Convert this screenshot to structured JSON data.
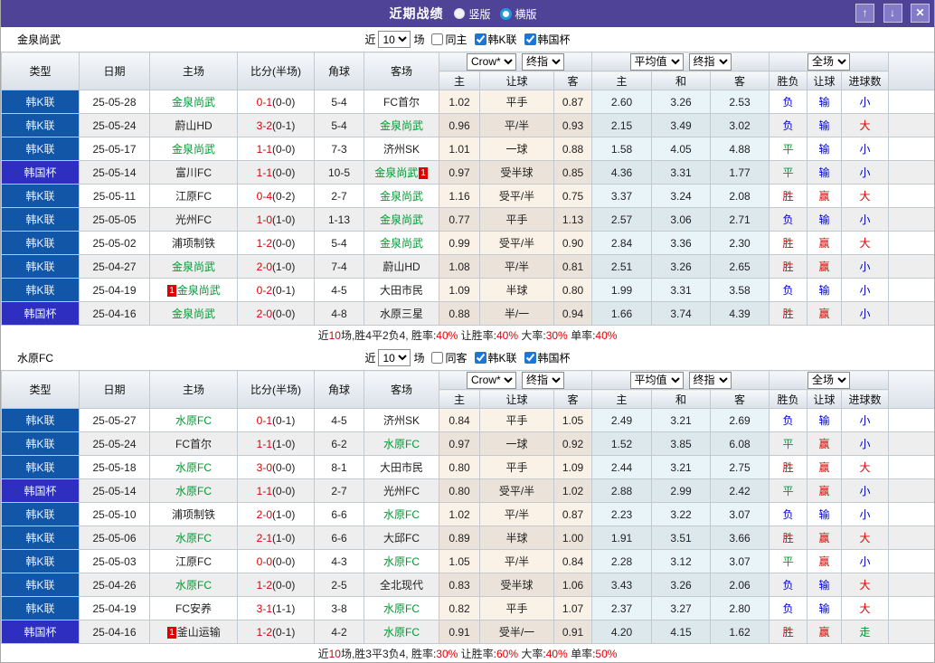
{
  "titlebar": {
    "title": "近期战绩",
    "layout_options": [
      {
        "label": "竖版",
        "selected": false
      },
      {
        "label": "横版",
        "selected": true
      }
    ],
    "window_buttons": {
      "up": "↑",
      "down": "↓",
      "close": "✕"
    }
  },
  "table_header": {
    "left_columns": [
      "类型",
      "日期",
      "主场",
      "比分(半场)",
      "角球",
      "客场"
    ],
    "odds_group": {
      "company_select": "Crow*",
      "stage_select": "终指",
      "subheaders": [
        "主",
        "让球",
        "客"
      ]
    },
    "avg_group": {
      "avg_select": "平均值",
      "stage_select": "终指",
      "subheaders": [
        "主",
        "和",
        "客"
      ]
    },
    "result_group": {
      "scope_select": "全场",
      "subheaders": [
        "胜负",
        "让球",
        "进球数"
      ]
    }
  },
  "colors": {
    "titlebar_bg": "#4f4398",
    "league_type_bg": "#1256a8",
    "cup_type_bg": "#2e2ec0",
    "focus_team": "#009933",
    "win_red": "#e10000",
    "draw_green": "#009933",
    "loss_blue": "#0000cc"
  },
  "sections": [
    {
      "team": "金泉尚武",
      "filter": {
        "prefix": "近",
        "count": "10",
        "suffix": "场",
        "same": {
          "label": "同主",
          "checked": false
        },
        "league": {
          "label": "韩K联",
          "checked": true
        },
        "cup": {
          "label": "韩国杯",
          "checked": true
        }
      },
      "rows": [
        {
          "type": "韩K联",
          "cup": false,
          "date": "25-05-28",
          "home": {
            "name": "金泉尚武",
            "focus": true
          },
          "score": "0-1",
          "half": "(0-0)",
          "corner": "5-4",
          "away": {
            "name": "FC首尔",
            "focus": false
          },
          "odds": [
            "1.02",
            "平手",
            "0.87"
          ],
          "avg": [
            "2.60",
            "3.26",
            "2.53"
          ],
          "res": [
            [
              "负",
              "B"
            ],
            [
              "输",
              "B"
            ],
            [
              "小",
              "B"
            ]
          ]
        },
        {
          "type": "韩K联",
          "cup": false,
          "date": "25-05-24",
          "home": {
            "name": "蔚山HD",
            "focus": false
          },
          "score": "3-2",
          "half": "(0-1)",
          "corner": "5-4",
          "away": {
            "name": "金泉尚武",
            "focus": true
          },
          "odds": [
            "0.96",
            "平/半",
            "0.93"
          ],
          "avg": [
            "2.15",
            "3.49",
            "3.02"
          ],
          "res": [
            [
              "负",
              "B"
            ],
            [
              "输",
              "B"
            ],
            [
              "大",
              "R"
            ]
          ]
        },
        {
          "type": "韩K联",
          "cup": false,
          "date": "25-05-17",
          "home": {
            "name": "金泉尚武",
            "focus": true
          },
          "score": "1-1",
          "half": "(0-0)",
          "corner": "7-3",
          "away": {
            "name": "济州SK",
            "focus": false
          },
          "odds": [
            "1.01",
            "一球",
            "0.88"
          ],
          "avg": [
            "1.58",
            "4.05",
            "4.88"
          ],
          "res": [
            [
              "平",
              "G"
            ],
            [
              "输",
              "B"
            ],
            [
              "小",
              "B"
            ]
          ]
        },
        {
          "type": "韩国杯",
          "cup": true,
          "date": "25-05-14",
          "home": {
            "name": "富川FC",
            "focus": false
          },
          "score": "1-1",
          "half": "(0-0)",
          "corner": "10-5",
          "away": {
            "name": "金泉尚武",
            "focus": true,
            "badge": "1",
            "badge_pos": "after"
          },
          "odds": [
            "0.97",
            "受半球",
            "0.85"
          ],
          "avg": [
            "4.36",
            "3.31",
            "1.77"
          ],
          "res": [
            [
              "平",
              "G"
            ],
            [
              "输",
              "B"
            ],
            [
              "小",
              "B"
            ]
          ]
        },
        {
          "type": "韩K联",
          "cup": false,
          "date": "25-05-11",
          "home": {
            "name": "江原FC",
            "focus": false
          },
          "score": "0-4",
          "half": "(0-2)",
          "corner": "2-7",
          "away": {
            "name": "金泉尚武",
            "focus": true
          },
          "odds": [
            "1.16",
            "受平/半",
            "0.75"
          ],
          "avg": [
            "3.37",
            "3.24",
            "2.08"
          ],
          "res": [
            [
              "胜",
              "R"
            ],
            [
              "赢",
              "R"
            ],
            [
              "大",
              "R"
            ]
          ]
        },
        {
          "type": "韩K联",
          "cup": false,
          "date": "25-05-05",
          "home": {
            "name": "光州FC",
            "focus": false
          },
          "score": "1-0",
          "half": "(1-0)",
          "corner": "1-13",
          "away": {
            "name": "金泉尚武",
            "focus": true
          },
          "odds": [
            "0.77",
            "平手",
            "1.13"
          ],
          "avg": [
            "2.57",
            "3.06",
            "2.71"
          ],
          "res": [
            [
              "负",
              "B"
            ],
            [
              "输",
              "B"
            ],
            [
              "小",
              "B"
            ]
          ]
        },
        {
          "type": "韩K联",
          "cup": false,
          "date": "25-05-02",
          "home": {
            "name": "浦项制铁",
            "focus": false
          },
          "score": "1-2",
          "half": "(0-0)",
          "corner": "5-4",
          "away": {
            "name": "金泉尚武",
            "focus": true
          },
          "odds": [
            "0.99",
            "受平/半",
            "0.90"
          ],
          "avg": [
            "2.84",
            "3.36",
            "2.30"
          ],
          "res": [
            [
              "胜",
              "R"
            ],
            [
              "赢",
              "R"
            ],
            [
              "大",
              "R"
            ]
          ]
        },
        {
          "type": "韩K联",
          "cup": false,
          "date": "25-04-27",
          "home": {
            "name": "金泉尚武",
            "focus": true
          },
          "score": "2-0",
          "half": "(1-0)",
          "corner": "7-4",
          "away": {
            "name": "蔚山HD",
            "focus": false
          },
          "odds": [
            "1.08",
            "平/半",
            "0.81"
          ],
          "avg": [
            "2.51",
            "3.26",
            "2.65"
          ],
          "res": [
            [
              "胜",
              "R"
            ],
            [
              "赢",
              "R"
            ],
            [
              "小",
              "B"
            ]
          ]
        },
        {
          "type": "韩K联",
          "cup": false,
          "date": "25-04-19",
          "home": {
            "name": "金泉尚武",
            "focus": true,
            "badge": "1",
            "badge_pos": "before"
          },
          "score": "0-2",
          "half": "(0-1)",
          "corner": "4-5",
          "away": {
            "name": "大田市民",
            "focus": false
          },
          "odds": [
            "1.09",
            "半球",
            "0.80"
          ],
          "avg": [
            "1.99",
            "3.31",
            "3.58"
          ],
          "res": [
            [
              "负",
              "B"
            ],
            [
              "输",
              "B"
            ],
            [
              "小",
              "B"
            ]
          ]
        },
        {
          "type": "韩国杯",
          "cup": true,
          "date": "25-04-16",
          "home": {
            "name": "金泉尚武",
            "focus": true
          },
          "score": "2-0",
          "half": "(0-0)",
          "corner": "4-8",
          "away": {
            "name": "水原三星",
            "focus": false
          },
          "odds": [
            "0.88",
            "半/一",
            "0.94"
          ],
          "avg": [
            "1.66",
            "3.74",
            "4.39"
          ],
          "res": [
            [
              "胜",
              "R"
            ],
            [
              "赢",
              "R"
            ],
            [
              "小",
              "B"
            ]
          ]
        }
      ],
      "summary": [
        [
          "近",
          0
        ],
        [
          "10",
          1
        ],
        [
          "场,胜4平2负4, 胜率:",
          0
        ],
        [
          "40%",
          1
        ],
        [
          " 让胜率:",
          0
        ],
        [
          "40%",
          1
        ],
        [
          " 大率:",
          0
        ],
        [
          "30%",
          1
        ],
        [
          " 单率:",
          0
        ],
        [
          "40%",
          1
        ]
      ]
    },
    {
      "team": "水原FC",
      "filter": {
        "prefix": "近",
        "count": "10",
        "suffix": "场",
        "same": {
          "label": "同客",
          "checked": false
        },
        "league": {
          "label": "韩K联",
          "checked": true
        },
        "cup": {
          "label": "韩国杯",
          "checked": true
        }
      },
      "rows": [
        {
          "type": "韩K联",
          "cup": false,
          "date": "25-05-27",
          "home": {
            "name": "水原FC",
            "focus": true
          },
          "score": "0-1",
          "half": "(0-1)",
          "corner": "4-5",
          "away": {
            "name": "济州SK",
            "focus": false
          },
          "odds": [
            "0.84",
            "平手",
            "1.05"
          ],
          "avg": [
            "2.49",
            "3.21",
            "2.69"
          ],
          "res": [
            [
              "负",
              "B"
            ],
            [
              "输",
              "B"
            ],
            [
              "小",
              "B"
            ]
          ]
        },
        {
          "type": "韩K联",
          "cup": false,
          "date": "25-05-24",
          "home": {
            "name": "FC首尔",
            "focus": false
          },
          "score": "1-1",
          "half": "(1-0)",
          "corner": "6-2",
          "away": {
            "name": "水原FC",
            "focus": true
          },
          "odds": [
            "0.97",
            "一球",
            "0.92"
          ],
          "avg": [
            "1.52",
            "3.85",
            "6.08"
          ],
          "res": [
            [
              "平",
              "G"
            ],
            [
              "赢",
              "R"
            ],
            [
              "小",
              "B"
            ]
          ]
        },
        {
          "type": "韩K联",
          "cup": false,
          "date": "25-05-18",
          "home": {
            "name": "水原FC",
            "focus": true
          },
          "score": "3-0",
          "half": "(0-0)",
          "corner": "8-1",
          "away": {
            "name": "大田市民",
            "focus": false
          },
          "odds": [
            "0.80",
            "平手",
            "1.09"
          ],
          "avg": [
            "2.44",
            "3.21",
            "2.75"
          ],
          "res": [
            [
              "胜",
              "R"
            ],
            [
              "赢",
              "R"
            ],
            [
              "大",
              "R"
            ]
          ]
        },
        {
          "type": "韩国杯",
          "cup": true,
          "date": "25-05-14",
          "home": {
            "name": "水原FC",
            "focus": true
          },
          "score": "1-1",
          "half": "(0-0)",
          "corner": "2-7",
          "away": {
            "name": "光州FC",
            "focus": false
          },
          "odds": [
            "0.80",
            "受平/半",
            "1.02"
          ],
          "avg": [
            "2.88",
            "2.99",
            "2.42"
          ],
          "res": [
            [
              "平",
              "G"
            ],
            [
              "赢",
              "R"
            ],
            [
              "小",
              "B"
            ]
          ]
        },
        {
          "type": "韩K联",
          "cup": false,
          "date": "25-05-10",
          "home": {
            "name": "浦项制铁",
            "focus": false
          },
          "score": "2-0",
          "half": "(1-0)",
          "corner": "6-6",
          "away": {
            "name": "水原FC",
            "focus": true
          },
          "odds": [
            "1.02",
            "平/半",
            "0.87"
          ],
          "avg": [
            "2.23",
            "3.22",
            "3.07"
          ],
          "res": [
            [
              "负",
              "B"
            ],
            [
              "输",
              "B"
            ],
            [
              "小",
              "B"
            ]
          ]
        },
        {
          "type": "韩K联",
          "cup": false,
          "date": "25-05-06",
          "home": {
            "name": "水原FC",
            "focus": true
          },
          "score": "2-1",
          "half": "(1-0)",
          "corner": "6-6",
          "away": {
            "name": "大邱FC",
            "focus": false
          },
          "odds": [
            "0.89",
            "半球",
            "1.00"
          ],
          "avg": [
            "1.91",
            "3.51",
            "3.66"
          ],
          "res": [
            [
              "胜",
              "R"
            ],
            [
              "赢",
              "R"
            ],
            [
              "大",
              "R"
            ]
          ]
        },
        {
          "type": "韩K联",
          "cup": false,
          "date": "25-05-03",
          "home": {
            "name": "江原FC",
            "focus": false
          },
          "score": "0-0",
          "half": "(0-0)",
          "corner": "4-3",
          "away": {
            "name": "水原FC",
            "focus": true
          },
          "odds": [
            "1.05",
            "平/半",
            "0.84"
          ],
          "avg": [
            "2.28",
            "3.12",
            "3.07"
          ],
          "res": [
            [
              "平",
              "G"
            ],
            [
              "赢",
              "R"
            ],
            [
              "小",
              "B"
            ]
          ]
        },
        {
          "type": "韩K联",
          "cup": false,
          "date": "25-04-26",
          "home": {
            "name": "水原FC",
            "focus": true
          },
          "score": "1-2",
          "half": "(0-0)",
          "corner": "2-5",
          "away": {
            "name": "全北现代",
            "focus": false
          },
          "odds": [
            "0.83",
            "受半球",
            "1.06"
          ],
          "avg": [
            "3.43",
            "3.26",
            "2.06"
          ],
          "res": [
            [
              "负",
              "B"
            ],
            [
              "输",
              "B"
            ],
            [
              "大",
              "R"
            ]
          ]
        },
        {
          "type": "韩K联",
          "cup": false,
          "date": "25-04-19",
          "home": {
            "name": "FC安养",
            "focus": false
          },
          "score": "3-1",
          "half": "(1-1)",
          "corner": "3-8",
          "away": {
            "name": "水原FC",
            "focus": true
          },
          "odds": [
            "0.82",
            "平手",
            "1.07"
          ],
          "avg": [
            "2.37",
            "3.27",
            "2.80"
          ],
          "res": [
            [
              "负",
              "B"
            ],
            [
              "输",
              "B"
            ],
            [
              "大",
              "R"
            ]
          ]
        },
        {
          "type": "韩国杯",
          "cup": true,
          "date": "25-04-16",
          "home": {
            "name": "釜山运输",
            "focus": false,
            "badge": "1",
            "badge_pos": "before"
          },
          "score": "1-2",
          "half": "(0-1)",
          "corner": "4-2",
          "away": {
            "name": "水原FC",
            "focus": true
          },
          "odds": [
            "0.91",
            "受半/一",
            "0.91"
          ],
          "avg": [
            "4.20",
            "4.15",
            "1.62"
          ],
          "res": [
            [
              "胜",
              "R"
            ],
            [
              "赢",
              "R"
            ],
            [
              "走",
              "G"
            ]
          ]
        }
      ],
      "summary": [
        [
          "近",
          0
        ],
        [
          "10",
          1
        ],
        [
          "场,胜3平3负4, 胜率:",
          0
        ],
        [
          "30%",
          1
        ],
        [
          " 让胜率:",
          0
        ],
        [
          "60%",
          1
        ],
        [
          " 大率:",
          0
        ],
        [
          "40%",
          1
        ],
        [
          " 单率:",
          0
        ],
        [
          "50%",
          1
        ]
      ]
    }
  ]
}
